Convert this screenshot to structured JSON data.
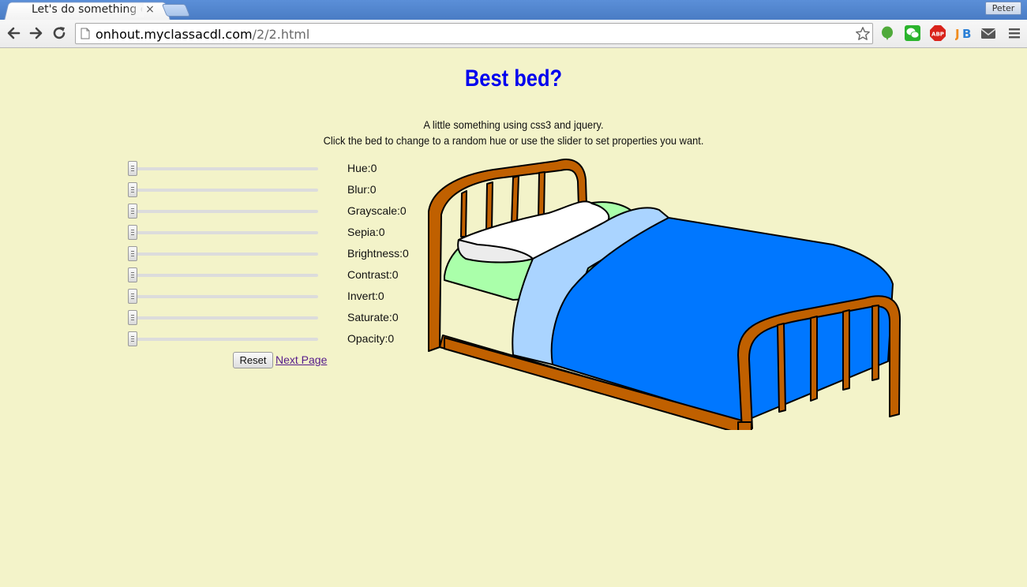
{
  "browser": {
    "tab_title": "Let's do something cool",
    "user_name": "Peter",
    "url_host": "onhout.myclassacdl.com",
    "url_path": "/2/2.html",
    "extensions": [
      "evernote-icon",
      "wechat-icon",
      "adblock-icon",
      "jb-icon",
      "mail-icon"
    ]
  },
  "page": {
    "title": "Best bed?",
    "intro_line1": "A little something using css3 and jquery.",
    "intro_line2": "Click the bed to change to a random hue or use the slider to set properties you want.",
    "sliders": [
      {
        "label": "Hue:0",
        "value": 0
      },
      {
        "label": "Blur:0",
        "value": 0
      },
      {
        "label": "Grayscale:0",
        "value": 0
      },
      {
        "label": "Sepia:0",
        "value": 0
      },
      {
        "label": "Brightness:0",
        "value": 0
      },
      {
        "label": "Contrast:0",
        "value": 0
      },
      {
        "label": "Invert:0",
        "value": 0
      },
      {
        "label": "Saturate:0",
        "value": 0
      },
      {
        "label": "Opacity:0",
        "value": 0
      }
    ],
    "reset_label": "Reset",
    "next_link": "Next Page"
  },
  "colors": {
    "background": "#f3f3c9",
    "heading": "#0000ee",
    "bed_frame": "#c06000",
    "blanket": "#0077ff",
    "sheet": "#aad4ff",
    "mattress": "#aaffaa",
    "pillow": "#ffffff"
  }
}
